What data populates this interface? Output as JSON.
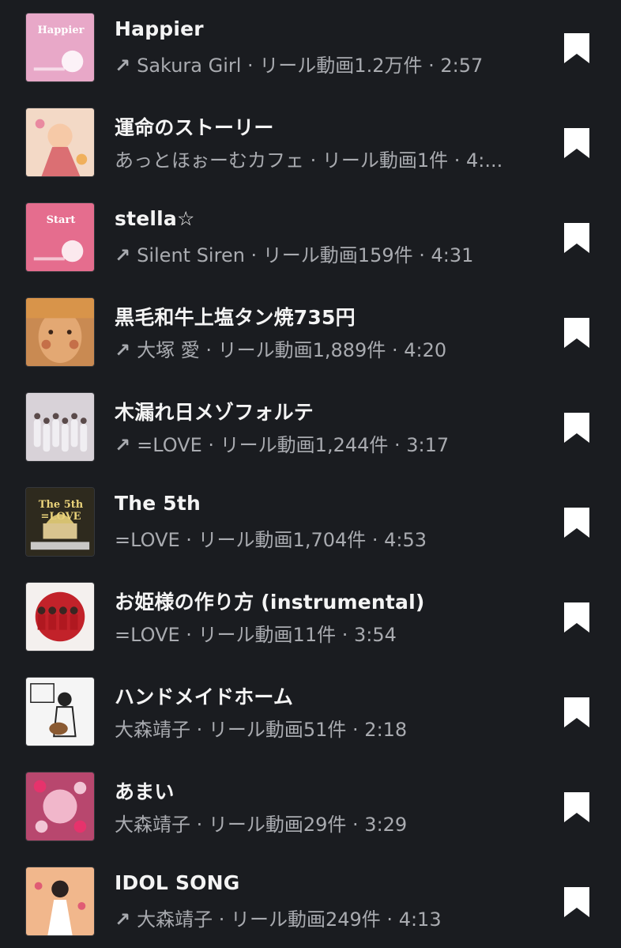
{
  "songs": [
    {
      "title": "Happier",
      "trending": true,
      "meta": "Sakura Girl · リール動画1.2万件 · 2:57",
      "art": {
        "bg": "#e8a8c8",
        "accent": "#ffffff",
        "text": "Happier",
        "style": "label"
      }
    },
    {
      "title": "運命のストーリー",
      "trending": false,
      "meta": "あっとほぉーむカフェ · リール動画1件 · 4:...",
      "art": {
        "bg": "#f3d9c6",
        "accent": "#d4545e",
        "style": "illustration"
      }
    },
    {
      "title": "stella☆",
      "trending": true,
      "meta": "Silent Siren · リール動画159件 · 4:31",
      "art": {
        "bg": "#e56d8e",
        "accent": "#ffffff",
        "text": "Start",
        "style": "label"
      }
    },
    {
      "title": "黒毛和牛上塩タン焼735円",
      "trending": true,
      "meta": "大塚 愛 · リール動画1,889件 · 4:20",
      "art": {
        "bg": "#e3a873",
        "accent": "#b04a2c",
        "style": "face"
      }
    },
    {
      "title": "木漏れ日メゾフォルテ",
      "trending": true,
      "meta": "=LOVE · リール動画1,244件 · 3:17",
      "art": {
        "bg": "#d8d2d8",
        "accent": "#f0eef2",
        "style": "group"
      }
    },
    {
      "title": "The 5th",
      "trending": false,
      "meta": "=LOVE · リール動画1,704件 · 4:53",
      "art": {
        "bg": "#2e2a1e",
        "accent": "#e9d27a",
        "text": "The 5th =LOVE",
        "style": "building"
      }
    },
    {
      "title": "お姫様の作り方 (instrumental)",
      "trending": false,
      "meta": "=LOVE · リール動画11件 · 3:54",
      "art": {
        "bg": "#f4f0ee",
        "accent": "#c2222a",
        "style": "redgroup"
      }
    },
    {
      "title": "ハンドメイドホーム",
      "trending": false,
      "meta": "大森靖子 · リール動画51件 · 2:18",
      "art": {
        "bg": "#f5f5f5",
        "accent": "#222222",
        "style": "sketch"
      }
    },
    {
      "title": "あまい",
      "trending": false,
      "meta": "大森靖子 · リール動画29件 · 3:29",
      "art": {
        "bg": "#b8476e",
        "accent": "#ffd3e2",
        "style": "pattern"
      }
    },
    {
      "title": "IDOL SONG",
      "trending": true,
      "meta": "大森靖子 · リール動画249件 · 4:13",
      "art": {
        "bg": "#f1b78c",
        "accent": "#ffffff",
        "style": "figure"
      }
    }
  ],
  "icons": {
    "trend": "trending-arrow-icon",
    "save": "bookmark-icon"
  },
  "colors": {
    "background": "#1a1c20",
    "title": "#f4f4f4",
    "meta": "#a9abb0",
    "bookmark": "#ffffff"
  }
}
